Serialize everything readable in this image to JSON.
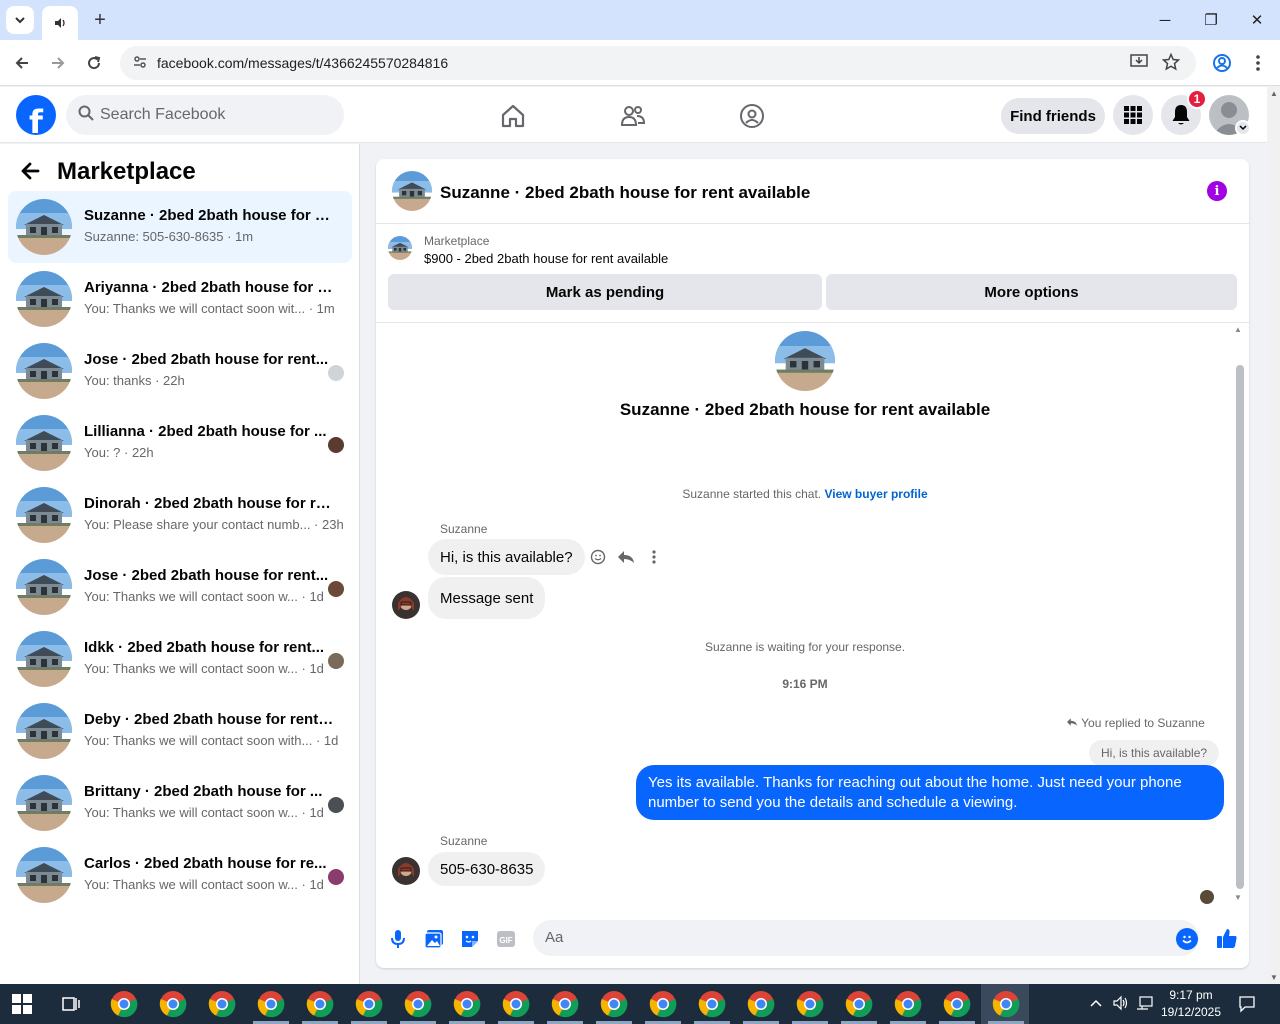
{
  "browser": {
    "url": "facebook.com/messages/t/4366245570284816",
    "tab_dropdown_icon": "chevron-down-icon",
    "tab_icon": "speaker-icon",
    "new_tab_label": "+",
    "win_min": "─",
    "win_max": "❐",
    "win_close": "✕"
  },
  "fb": {
    "search_placeholder": "Search Facebook",
    "find_friends_label": "Find friends",
    "notifications_count": "1",
    "logo_letter": "f",
    "brand_color": "#0866ff"
  },
  "sidebar": {
    "title": "Marketplace",
    "conversations": [
      {
        "name": "Suzanne · 2bed 2bath house for re...",
        "snippet": "Suzanne: 505-630-8635 · 1m"
      },
      {
        "name": "Ariyanna · 2bed 2bath house for r...",
        "snippet": "You: Thanks we will contact soon wit...  · 1m"
      },
      {
        "name": "Jose · 2bed 2bath house for rent...",
        "snippet": "You: thanks · 22h"
      },
      {
        "name": "Lillianna · 2bed 2bath house for ...",
        "snippet": "You: ? · 22h"
      },
      {
        "name": "Dinorah · 2bed 2bath house for re...",
        "snippet": "You: Please share your contact numb... · 23h"
      },
      {
        "name": "Jose · 2bed 2bath house for rent...",
        "snippet": "You: Thanks we will contact soon w... · 1d"
      },
      {
        "name": "Idkk · 2bed 2bath house for rent...",
        "snippet": "You: Thanks we will contact soon w... · 1d"
      },
      {
        "name": "Deby · 2bed 2bath house for rent ...",
        "snippet": "You: Thanks we will contact soon with... · 1d"
      },
      {
        "name": "Brittany · 2bed 2bath house for ...",
        "snippet": "You: Thanks we will contact soon w... · 1d"
      },
      {
        "name": "Carlos · 2bed 2bath house for re...",
        "snippet": "You: Thanks we will contact soon w... · 1d"
      }
    ]
  },
  "chat": {
    "title": "Suzanne · 2bed 2bath house for rent available",
    "marketplace_label": "Marketplace",
    "listing": "$900 - 2bed 2bath house for rent available",
    "mark_pending_label": "Mark as pending",
    "more_options_label": "More options",
    "intro_title": "Suzanne · 2bed 2bath house for rent available",
    "started_text": "Suzanne started this chat.",
    "view_buyer_label": "View buyer profile",
    "sender_name": "Suzanne",
    "msg1": "Hi, is this available?",
    "msg2": "Message sent",
    "waiting_text": "Suzanne is waiting for your response.",
    "time_label": "9:16 PM",
    "replied_label": "You replied to Suzanne",
    "quoted_text": "Hi, is this available?",
    "out_msg": "Yes its available. Thanks for reaching out about the home. Just need your phone number to send you the details and schedule a viewing.",
    "sender_name_2": "Suzanne",
    "msg3": "505-630-8635",
    "composer_placeholder": "Aa"
  },
  "taskbar": {
    "time": "9:17 pm",
    "date": "19/12/2025"
  }
}
